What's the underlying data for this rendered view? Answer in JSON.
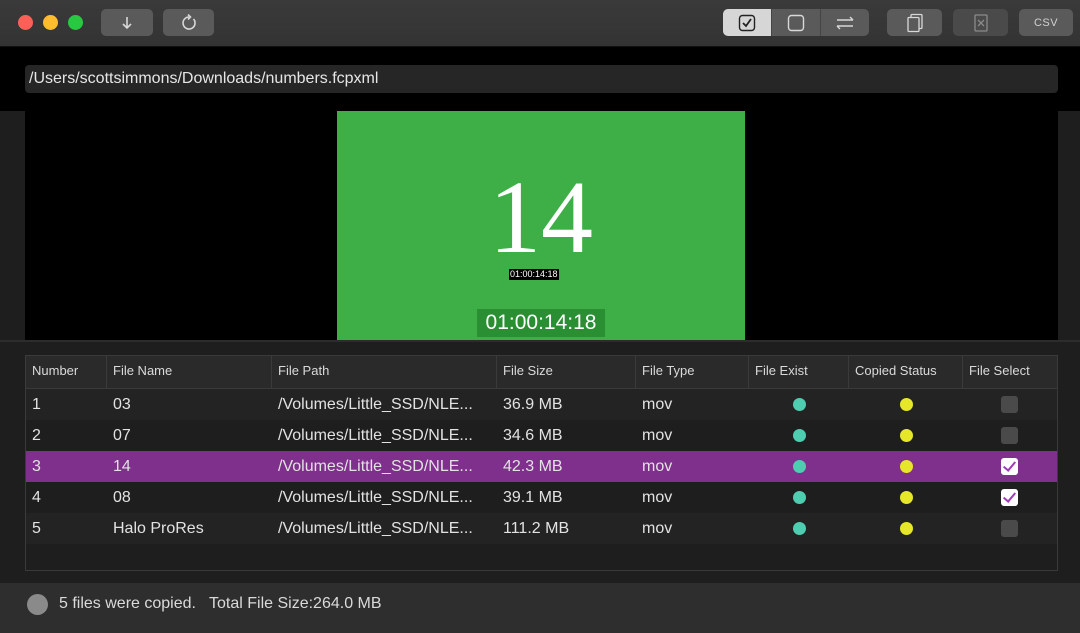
{
  "toolbar": {
    "download_icon": "arrow-down-icon",
    "refresh_icon": "refresh-icon",
    "select_all_icon": "checkbox-checked-icon",
    "deselect_all_icon": "checkbox-empty-icon",
    "invert_icon": "swap-arrows-icon",
    "copy_icon": "copy-icon",
    "delete_icon": "delete-icon",
    "csv_label": "CSV"
  },
  "path": {
    "value": "/Users/scottsimmons/Downloads/numbers.fcpxml"
  },
  "viewer": {
    "frame_number": "14",
    "burned_timecode": "01:00:14:18",
    "timecode": "01:00:14:18",
    "frame_color": "#3eae46"
  },
  "table": {
    "columns": [
      "Number",
      "File Name",
      "File Path",
      "File Size",
      "File Type",
      "File Exist",
      "Copied Status",
      "File Select"
    ],
    "rows": [
      {
        "number": "1",
        "name": "03",
        "path": "/Volumes/Little_SSD/NLE...",
        "size": "36.9 MB",
        "type": "mov",
        "exist": "green",
        "copied": "yellow",
        "selected": false
      },
      {
        "number": "2",
        "name": "07",
        "path": "/Volumes/Little_SSD/NLE...",
        "size": "34.6 MB",
        "type": "mov",
        "exist": "green",
        "copied": "yellow",
        "selected": false
      },
      {
        "number": "3",
        "name": "14",
        "path": "/Volumes/Little_SSD/NLE...",
        "size": "42.3 MB",
        "type": "mov",
        "exist": "green",
        "copied": "yellow",
        "selected": true
      },
      {
        "number": "4",
        "name": "08",
        "path": "/Volumes/Little_SSD/NLE...",
        "size": "39.1 MB",
        "type": "mov",
        "exist": "green",
        "copied": "yellow",
        "selected": true
      },
      {
        "number": "5",
        "name": "Halo ProRes",
        "path": "/Volumes/Little_SSD/NLE...",
        "size": "111.2 MB",
        "type": "mov",
        "exist": "green",
        "copied": "yellow",
        "selected": false
      }
    ],
    "highlighted_row": 2,
    "highlight_color": "#7f2f8c"
  },
  "status": {
    "message": "5 files were copied.",
    "total_label": "Total File Size:264.0 MB"
  }
}
